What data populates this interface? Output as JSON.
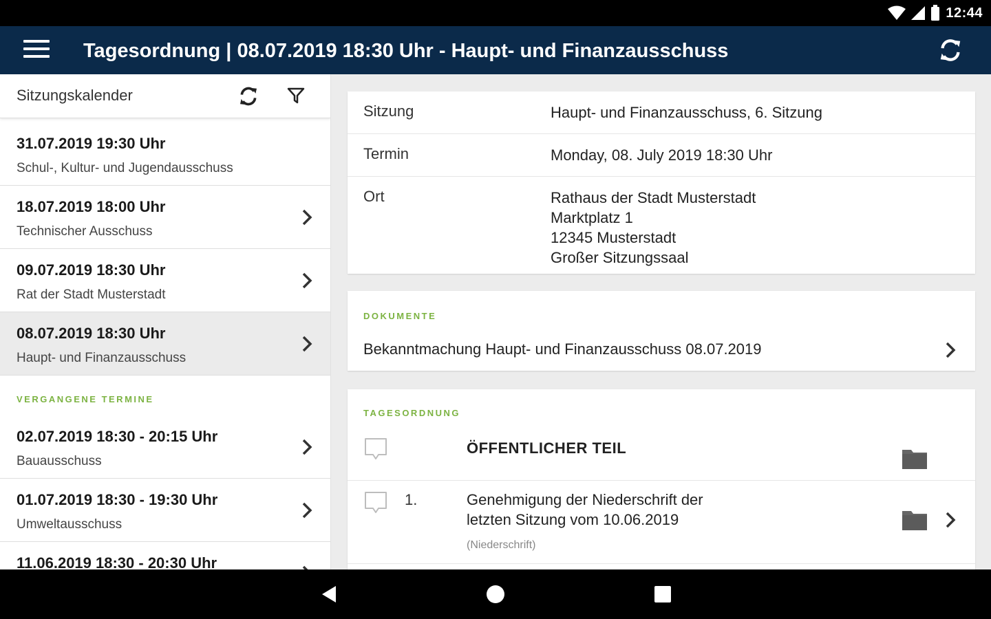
{
  "status_bar": {
    "time": "12:44",
    "icons": [
      "wifi-icon",
      "signal-icon",
      "battery-icon"
    ]
  },
  "app_bar": {
    "title": "Tagesordnung | 08.07.2019 18:30 Uhr - Haupt- und Finanzausschuss",
    "icons": [
      "menu-icon",
      "refresh-icon"
    ]
  },
  "sidebar": {
    "header_label": "Sitzungskalender",
    "upcoming": [
      {
        "date": "31.07.2019 19:30 Uhr",
        "name": "Schul-, Kultur- und Jugendausschuss",
        "has_chevron": false,
        "selected": false
      },
      {
        "date": "18.07.2019 18:00 Uhr",
        "name": "Technischer Ausschuss",
        "has_chevron": true,
        "selected": false
      },
      {
        "date": "09.07.2019 18:30 Uhr",
        "name": "Rat der Stadt Musterstadt",
        "has_chevron": true,
        "selected": false
      },
      {
        "date": "08.07.2019 18:30 Uhr",
        "name": "Haupt- und Finanzausschuss",
        "has_chevron": true,
        "selected": true
      }
    ],
    "past_label": "VERGANGENE TERMINE",
    "past": [
      {
        "date": "02.07.2019 18:30 - 20:15 Uhr",
        "name": "Bauausschuss",
        "has_chevron": true
      },
      {
        "date": "01.07.2019 18:30 - 19:30 Uhr",
        "name": "Umweltausschuss",
        "has_chevron": true
      },
      {
        "date": "11.06.2019 18:30 - 20:30 Uhr",
        "name": "",
        "has_chevron": true
      }
    ]
  },
  "info": {
    "sitzung_label": "Sitzung",
    "sitzung_value": "Haupt- und Finanzausschuss, 6. Sitzung",
    "termin_label": "Termin",
    "termin_value": "Monday, 08. July 2019 18:30 Uhr",
    "ort_label": "Ort",
    "ort_lines": [
      "Rathaus der Stadt Musterstadt",
      "Marktplatz 1",
      "12345 Musterstadt",
      "Großer Sitzungssaal"
    ]
  },
  "documents": {
    "label": "DOKUMENTE",
    "items": [
      "Bekanntmachung Haupt- und Finanzausschuss 08.07.2019"
    ]
  },
  "agenda": {
    "label": "TAGESORDNUNG",
    "items": [
      {
        "number": "",
        "title_lines": [
          "ÖFFENTLICHER TEIL"
        ],
        "subtitle": ""
      },
      {
        "number": "1.",
        "title_lines": [
          "Genehmigung der Niederschrift der",
          "letzten Sitzung vom 10.06.2019"
        ],
        "subtitle": "(Niederschrift)"
      }
    ]
  },
  "colors": {
    "app_bar": "#0b2a4a",
    "accent_green": "#7cb342",
    "selected_row": "#ebebeb"
  }
}
